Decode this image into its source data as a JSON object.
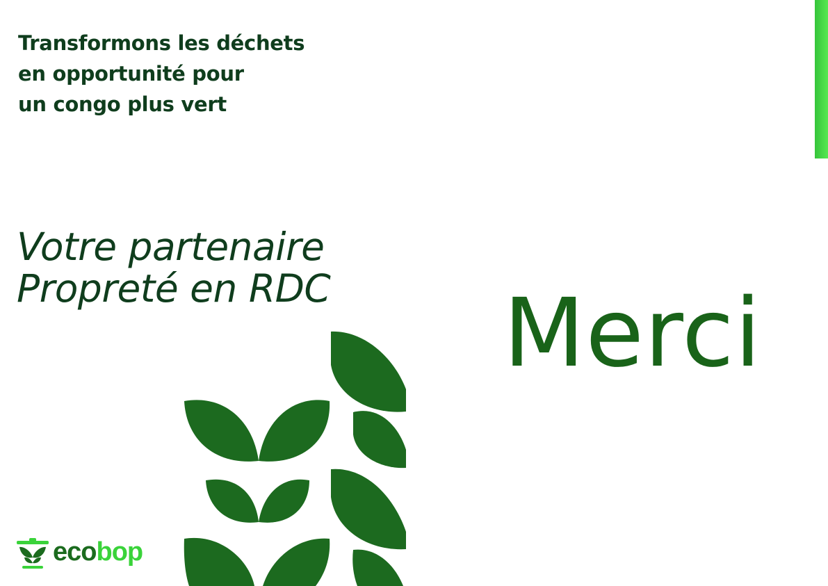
{
  "tagline": {
    "line1": "Transformons les déchets",
    "line2": "en opportunité pour",
    "line3": "un congo plus vert"
  },
  "subtitle": {
    "line1": "Votre partenaire",
    "line2": "Propreté en RDC"
  },
  "headline": "Merci",
  "logo": {
    "part1": "eco",
    "part2": "bop",
    "icon": "leaf-pot-icon"
  },
  "colors": {
    "dark_green_text": "#0f3d1d",
    "merci_green": "#196319",
    "leaf_green": "#1c6a1f",
    "bright_green": "#3ad33a"
  }
}
